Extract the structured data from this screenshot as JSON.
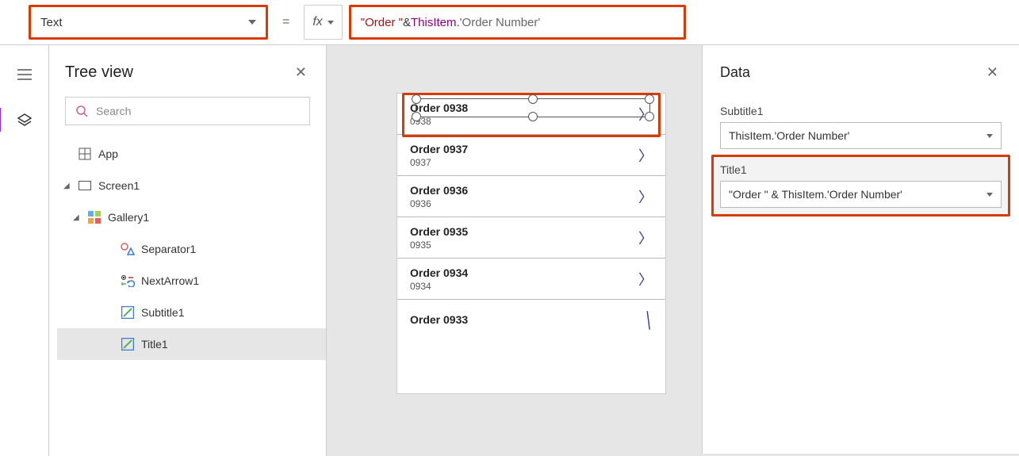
{
  "formulaBar": {
    "property": "Text",
    "fxLabel": "fx",
    "formula": {
      "str": "\"Order \"",
      "amp": " & ",
      "var": "ThisItem",
      "dot": ".",
      "prop": "'Order Number'"
    }
  },
  "treePanel": {
    "title": "Tree view",
    "searchPlaceholder": "Search",
    "items": {
      "app": "App",
      "screen1": "Screen1",
      "gallery1": "Gallery1",
      "separator1": "Separator1",
      "nextarrow1": "NextArrow1",
      "subtitle1": "Subtitle1",
      "title1": "Title1"
    }
  },
  "canvas": {
    "rows": [
      {
        "title": "Order 0938",
        "subtitle": "0938"
      },
      {
        "title": "Order 0937",
        "subtitle": "0937"
      },
      {
        "title": "Order 0936",
        "subtitle": "0936"
      },
      {
        "title": "Order 0935",
        "subtitle": "0935"
      },
      {
        "title": "Order 0934",
        "subtitle": "0934"
      },
      {
        "title": "Order 0933",
        "subtitle": ""
      }
    ]
  },
  "dataPanel": {
    "title": "Data",
    "fields": [
      {
        "label": "Subtitle1",
        "value": "ThisItem.'Order Number'"
      },
      {
        "label": "Title1",
        "value": "\"Order \" & ThisItem.'Order Number'"
      }
    ]
  }
}
